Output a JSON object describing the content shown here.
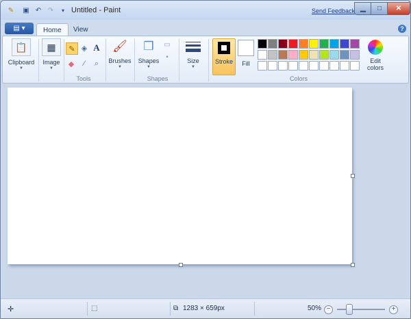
{
  "window": {
    "title": "Untitled - Paint",
    "send_feedback": "Send Feedback",
    "quick_access": [
      "paint-app-icon",
      "save-icon",
      "undo-icon",
      "redo-icon",
      "customize-dropdown-icon"
    ]
  },
  "tabs": [
    {
      "label": "Home",
      "active": true
    },
    {
      "label": "View",
      "active": false
    }
  ],
  "ribbon": {
    "clipboard": {
      "label": "Clipboard"
    },
    "image": {
      "label": "Image"
    },
    "tools": {
      "group_label": "Tools",
      "items": [
        "pencil-icon",
        "fill-bucket-icon",
        "text-icon",
        "eraser-icon",
        "color-picker-icon",
        "magnifier-icon"
      ]
    },
    "brushes": {
      "label": "Brushes"
    },
    "shapes": {
      "label": "Shapes",
      "group_label": "Shapes"
    },
    "size": {
      "label": "Size"
    },
    "colors": {
      "group_label": "Colors",
      "stroke_label": "Stroke",
      "fill_label": "Fill",
      "edit_colors_label": "Edit colors",
      "stroke_color": "#000000",
      "fill_color": "#ffffff",
      "palette_row1": [
        "#000000",
        "#7f7f7f",
        "#880015",
        "#ed1c24",
        "#ff7f27",
        "#fff200",
        "#22b14c",
        "#00a2e8",
        "#3f48cc",
        "#a349a4"
      ],
      "palette_row2": [
        "#ffffff",
        "#c3c3c3",
        "#b97a57",
        "#ffaec9",
        "#ffc90e",
        "#efe4b0",
        "#b5e61d",
        "#99d9ea",
        "#7092be",
        "#c8bfe7"
      ],
      "palette_row3": [
        "#ffffff",
        "#ffffff",
        "#ffffff",
        "#ffffff",
        "#ffffff",
        "#ffffff",
        "#ffffff",
        "#ffffff",
        "#ffffff",
        "#ffffff"
      ]
    }
  },
  "status": {
    "image_size": "1283 × 659px",
    "zoom": "50%",
    "zoom_level": 0.5
  }
}
